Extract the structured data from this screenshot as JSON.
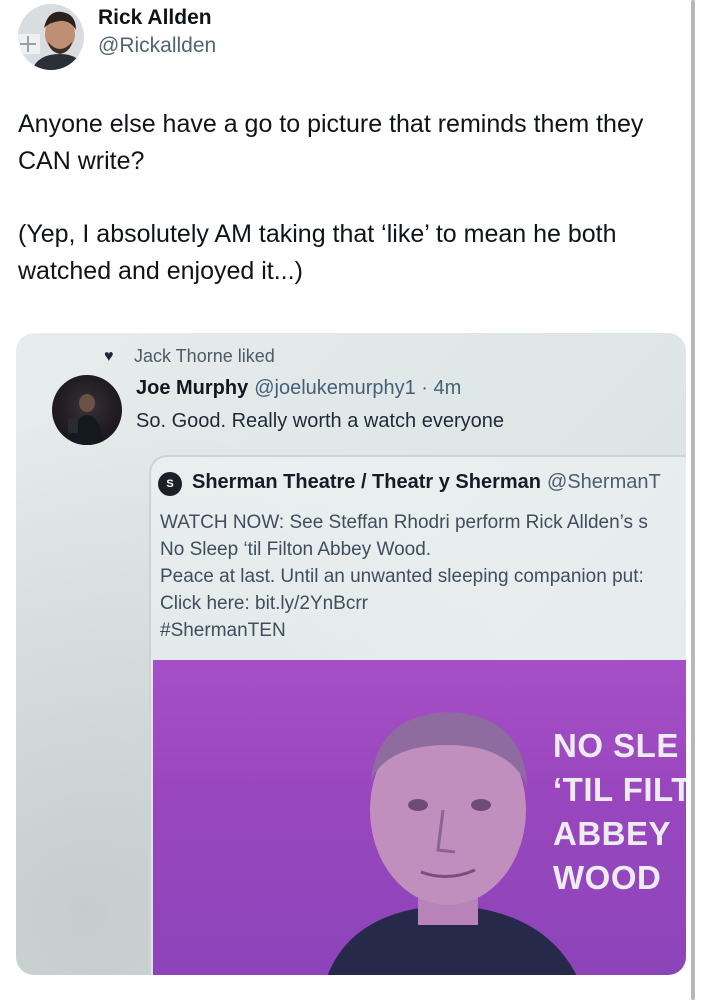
{
  "author": {
    "name": "Rick Allden",
    "handle": "@Rickallden"
  },
  "tweet": {
    "paragraphs": [
      "Anyone else have a go to picture that reminds them they CAN write?",
      "(Yep, I absolutely AM taking that ‘like’ to mean he both watched and enjoyed it...)"
    ]
  },
  "photo": {
    "liked_by": "Jack Thorne liked",
    "reply": {
      "name": "Joe Murphy",
      "handle_time": "@joelukemurphy1 · 4m",
      "text": "So. Good. Really worth a watch everyone"
    },
    "quote": {
      "logo_letter": "S",
      "name": "Sherman Theatre / Theatr y Sherman",
      "handle": "@ShermanT",
      "lines": [
        "WATCH NOW: See Steffan Rhodri perform Rick Allden’s s",
        "No Sleep ‘til Filton Abbey Wood.",
        "Peace at last. Until an unwanted sleeping companion put:",
        "Click here: bit.ly/2YnBcrr",
        "#ShermanTEN"
      ]
    },
    "promo": {
      "lines": [
        "NO SLE",
        "‘TIL FILT",
        "ABBEY",
        "WOOD"
      ]
    }
  }
}
